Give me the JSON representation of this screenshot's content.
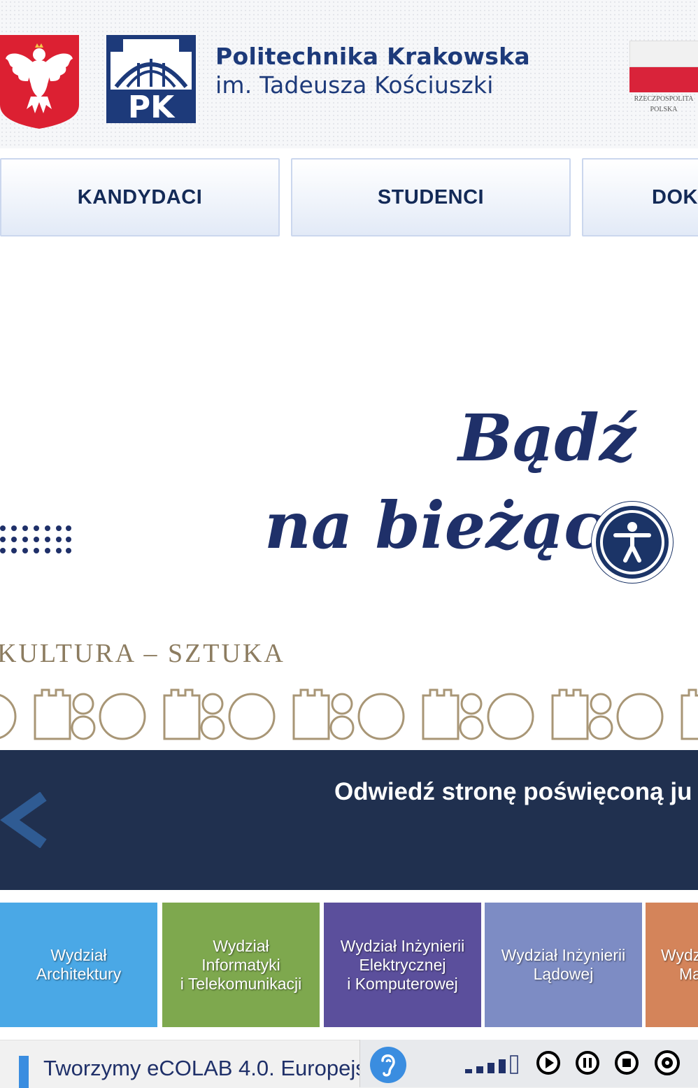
{
  "header": {
    "eagle_alt": "Godło Rzeczypospolitej Polskiej",
    "pk_logo_text": "PK",
    "university_line1": "Politechnika Krakowska",
    "university_line2": "im. Tadeusza Kościuszki",
    "flag_caption_1": "RZECZPOSPOLITA",
    "flag_caption_2": "POLSKA"
  },
  "nav": {
    "items": [
      {
        "label": "KANDYDACI"
      },
      {
        "label": "STUDENCI"
      },
      {
        "label": "DOK"
      }
    ]
  },
  "hero": {
    "line1": "Bądź",
    "line2": "na bieżąco",
    "subline": "KULTURA – SZTUKA"
  },
  "banner": {
    "text": "Odwiedź stronę poświęconą ju"
  },
  "faculties": [
    {
      "lines": [
        "Wydział",
        "Architektury"
      ],
      "color": "#4aa8e6"
    },
    {
      "lines": [
        "Wydział",
        "Informatyki",
        "i Telekomunikacji"
      ],
      "color": "#7ea84e"
    },
    {
      "lines": [
        "Wydział Inżynierii",
        "Elektrycznej",
        "i Komputerowej"
      ],
      "color": "#5b4f9c"
    },
    {
      "lines": [
        "Wydział Inżynierii",
        "Lądowej"
      ],
      "color": "#7d8cc4"
    },
    {
      "lines": [
        "Wydz",
        "Ma"
      ],
      "color": "#d4845a"
    }
  ],
  "news": {
    "text": "Tworzymy eCOLAB 4.0. Europejs"
  },
  "colors": {
    "navy": "#1f3069",
    "banner_bg": "#20304f",
    "accent_blue": "#3a8de0",
    "flag_red": "#d9233a"
  },
  "player": {
    "icons": [
      "hearing-icon",
      "volume-level-icon",
      "play-icon",
      "pause-icon",
      "stop-icon",
      "settings-icon"
    ]
  }
}
